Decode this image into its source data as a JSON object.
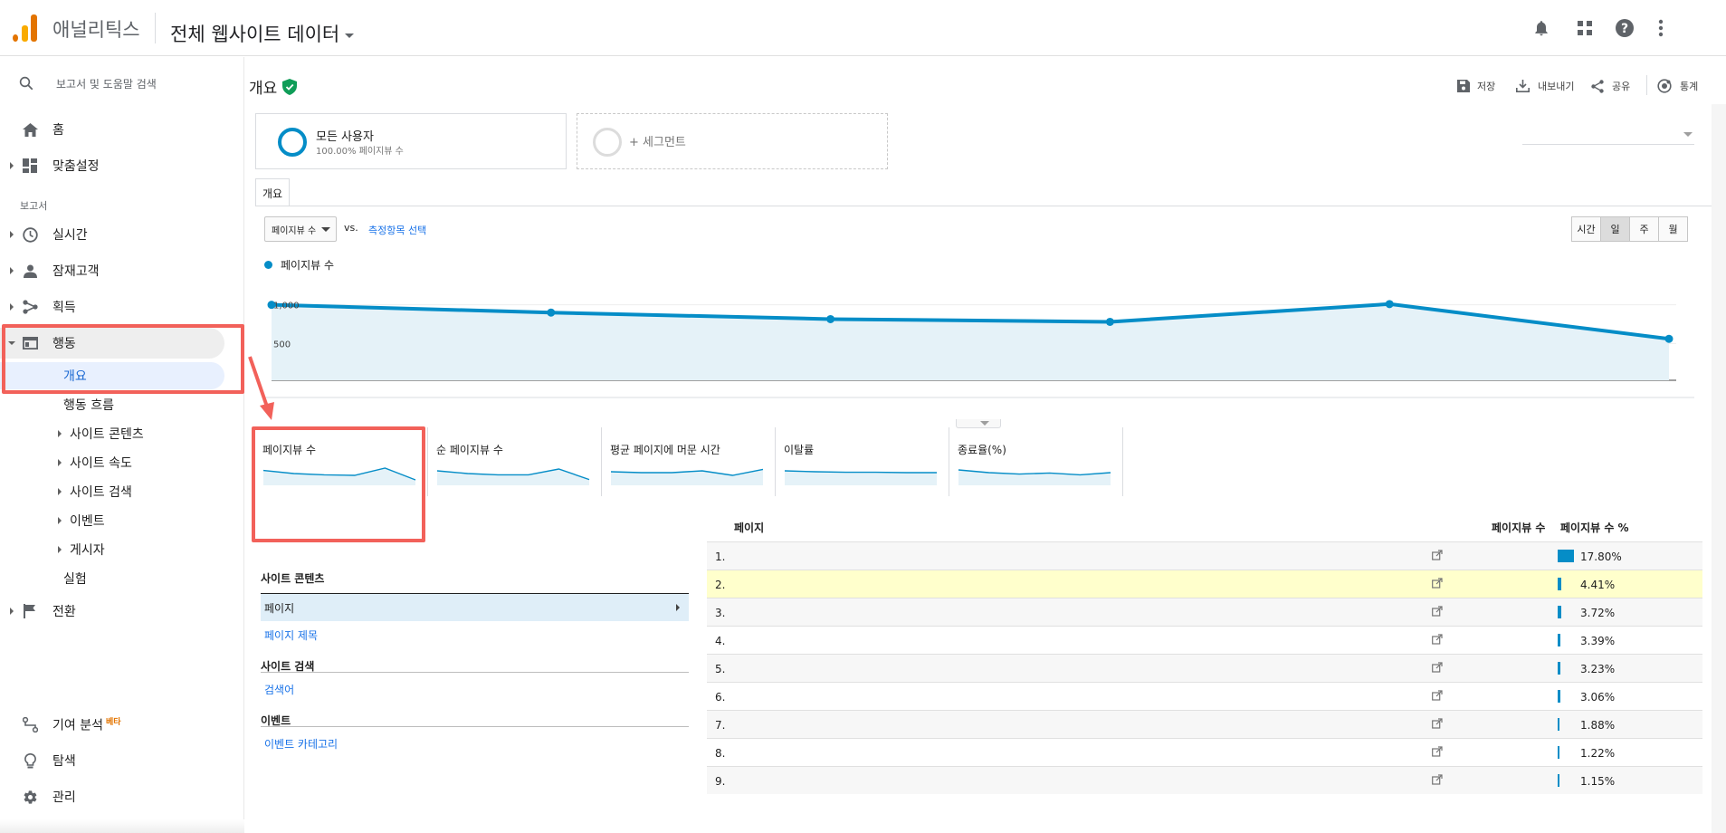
{
  "header": {
    "app_name": "애널리틱스",
    "property": "전체 웹사이트 데이터"
  },
  "sidebar": {
    "search_placeholder": "보고서 및 도움말 검색",
    "home": "홈",
    "customization": "맞춤설정",
    "reports_label": "보고서",
    "realtime": "실시간",
    "audience": "잠재고객",
    "acquisition": "획득",
    "behavior": "행동",
    "behavior_sub": {
      "overview": "개요",
      "flow": "행동 흐름",
      "site_content": "사이트 콘텐츠",
      "site_speed": "사이트 속도",
      "site_search": "사이트 검색",
      "events": "이벤트",
      "publisher": "게시자",
      "experiments": "실험"
    },
    "conversions": "전환",
    "attribution": "기여 분석",
    "attribution_badge": "베타",
    "discover": "탐색",
    "admin": "관리"
  },
  "page": {
    "title": "개요",
    "actions": {
      "save": "저장",
      "export": "내보내기",
      "share": "공유",
      "insights": "통계"
    },
    "segments": {
      "all_users": "모든 사용자",
      "all_users_sub": "100.00% 페이지뷰 수",
      "add_segment": "+ 세그먼트"
    },
    "tab": "개요",
    "metric_select": "페이지뷰 수",
    "vs": "vs.",
    "select_metric": "측정항목 선택",
    "periods": [
      "시간",
      "일",
      "주",
      "월"
    ],
    "active_period": "일",
    "legend": "페이지뷰 수"
  },
  "chart_data": {
    "type": "area",
    "series": [
      {
        "name": "페이지뷰 수",
        "values": [
          1000,
          900,
          815,
          780,
          1010,
          560
        ]
      }
    ],
    "ytick_labels": [
      "1,000",
      "500"
    ],
    "ylim": [
      0,
      1500
    ],
    "grid": true,
    "color": "#058dc7"
  },
  "sparklines": [
    {
      "label": "페이지뷰 수",
      "values": [
        0.62,
        0.45,
        0.38,
        0.35,
        0.75,
        0.1
      ]
    },
    {
      "label": "순 페이지뷰 수",
      "values": [
        0.6,
        0.45,
        0.38,
        0.38,
        0.7,
        0.12
      ]
    },
    {
      "label": "평균 페이지에 머문 시간",
      "values": [
        0.55,
        0.5,
        0.5,
        0.6,
        0.35,
        0.68
      ]
    },
    {
      "label": "이탈률",
      "values": [
        0.6,
        0.55,
        0.52,
        0.52,
        0.5,
        0.5
      ]
    },
    {
      "label": "종료율(%)",
      "values": [
        0.65,
        0.5,
        0.42,
        0.48,
        0.38,
        0.5
      ]
    }
  ],
  "left_table": {
    "site_content": "사이트 콘텐츠",
    "page": "페이지",
    "page_title": "페이지 제목",
    "site_search": "사이트 검색",
    "search_term": "검색어",
    "events": "이벤트",
    "event_category": "이벤트 카테고리"
  },
  "table": {
    "col_page": "페이지",
    "col_pageviews": "페이지뷰 수",
    "col_pct": "페이지뷰 수 %",
    "rows": [
      {
        "idx": "1.",
        "pct": "17.80%",
        "value": 17.8
      },
      {
        "idx": "2.",
        "pct": "4.41%",
        "value": 4.41
      },
      {
        "idx": "3.",
        "pct": "3.72%",
        "value": 3.72
      },
      {
        "idx": "4.",
        "pct": "3.39%",
        "value": 3.39
      },
      {
        "idx": "5.",
        "pct": "3.23%",
        "value": 3.23
      },
      {
        "idx": "6.",
        "pct": "3.06%",
        "value": 3.06
      },
      {
        "idx": "7.",
        "pct": "1.88%",
        "value": 1.88
      },
      {
        "idx": "8.",
        "pct": "1.22%",
        "value": 1.22
      },
      {
        "idx": "9.",
        "pct": "1.15%",
        "value": 1.15
      }
    ]
  }
}
